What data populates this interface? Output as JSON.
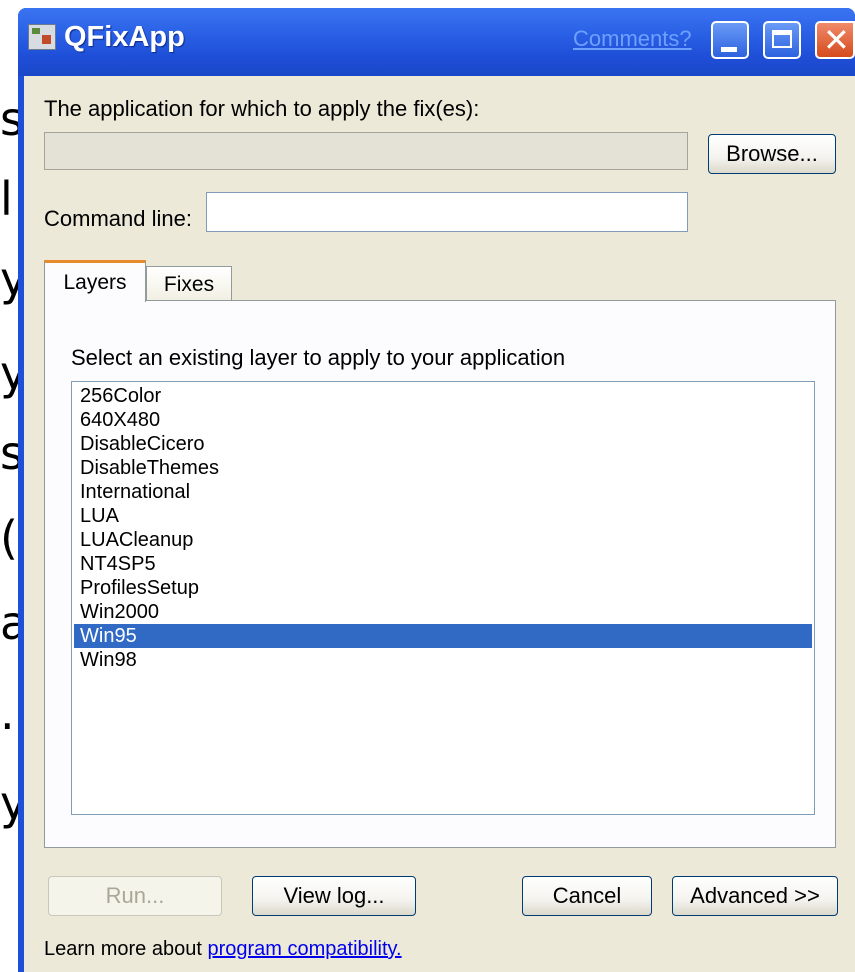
{
  "window": {
    "title": "QFixApp",
    "comments_link": "Comments?"
  },
  "form": {
    "app_label": "The application for which to apply the fix(es):",
    "app_value": "",
    "browse_label": "Browse...",
    "command_line_label": "Command line:",
    "command_line_value": ""
  },
  "tabs": [
    {
      "label": "Layers",
      "active": true
    },
    {
      "label": "Fixes",
      "active": false
    }
  ],
  "layers_panel": {
    "instruction": "Select an existing layer to apply to your application",
    "items": [
      {
        "label": "256Color",
        "selected": false
      },
      {
        "label": "640X480",
        "selected": false
      },
      {
        "label": "DisableCicero",
        "selected": false
      },
      {
        "label": "DisableThemes",
        "selected": false
      },
      {
        "label": "International",
        "selected": false
      },
      {
        "label": "LUA",
        "selected": false
      },
      {
        "label": "LUACleanup",
        "selected": false
      },
      {
        "label": "NT4SP5",
        "selected": false
      },
      {
        "label": "ProfilesSetup",
        "selected": false
      },
      {
        "label": "Win2000",
        "selected": false
      },
      {
        "label": "Win95",
        "selected": true
      },
      {
        "label": "Win98",
        "selected": false
      }
    ],
    "selection_color": "#316ac5"
  },
  "buttons": {
    "run": "Run...",
    "view_log": "View log...",
    "cancel": "Cancel",
    "advanced": "Advanced >>"
  },
  "footer": {
    "prefix": "Learn more about",
    "link": "program compatibility."
  },
  "left_crop_glyphs": [
    "s",
    "l",
    "y",
    "y",
    "s",
    "(",
    "a",
    ".",
    "y"
  ],
  "colors": {
    "titlebar": "#1f4fd8",
    "client_bg": "#ece9d8",
    "active_tab_accent": "#e68b2c"
  }
}
